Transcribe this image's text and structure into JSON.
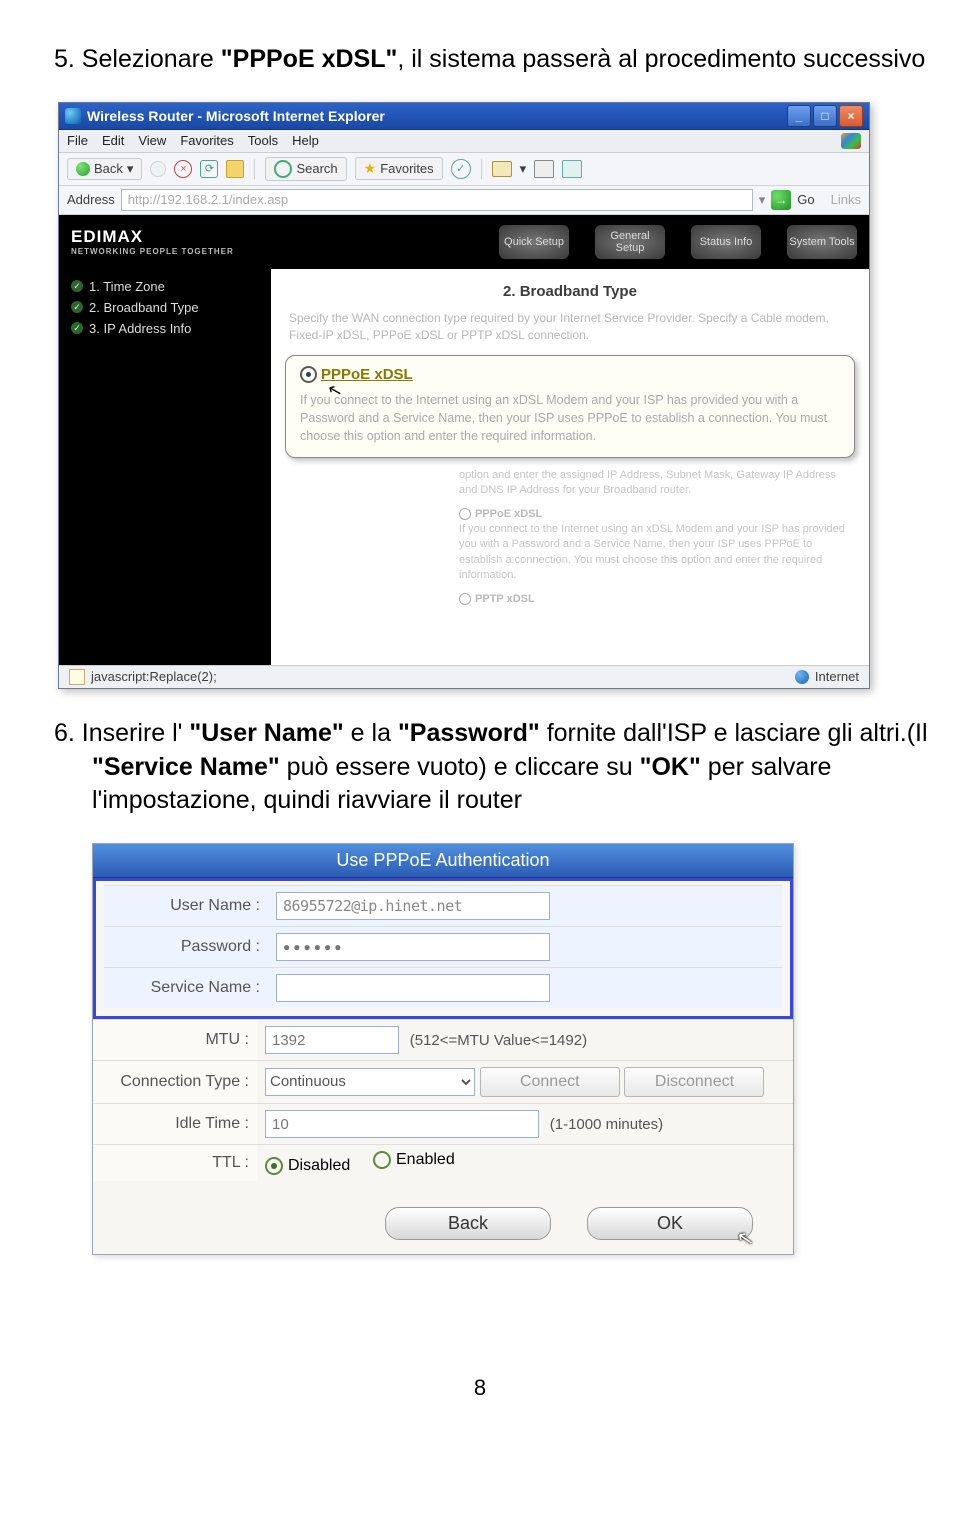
{
  "step5": {
    "number": "5.",
    "before": " Selezionare ",
    "term": "\"PPPoE xDSL\"",
    "after": ", il sistema passerà al procedimento successivo"
  },
  "shot1": {
    "title": "Wireless Router - Microsoft Internet Explorer",
    "menu": [
      "File",
      "Edit",
      "View",
      "Favorites",
      "Tools",
      "Help"
    ],
    "back": "Back",
    "search": "Search",
    "favorites": "Favorites",
    "address_label": "Address",
    "address_value": "http://192.168.2.1/index.asp",
    "go": "Go",
    "links": "Links",
    "logo": "EDIMAX",
    "logo_sub": "NETWORKING PEOPLE TOGETHER",
    "nav": [
      "Quick Setup",
      "General Setup",
      "Status Info",
      "System Tools"
    ],
    "sidebar": [
      "1. Time Zone",
      "2. Broadband Type",
      "3. IP Address Info"
    ],
    "h2": "2. Broadband Type",
    "intro": "Specify the WAN connection type required by your Internet Service Provider. Specify a Cable modem, Fixed-IP xDSL, PPPoE xDSL or PPTP xDSL connection.",
    "callout_title": "PPPoE xDSL",
    "callout_body": "If you connect to the Internet using an xDSL Modem and your ISP has provided you with a Password and a Service Name, then your ISP uses PPPoE to establish a connection. You must choose this option and enter the required information.",
    "faint1": "option and enter the assigned IP Address, Subnet Mask, Gateway IP Address and DNS IP Address for your Broadband router.",
    "faint2_title": "PPPoE xDSL",
    "faint2_body": "If you connect to the Internet using an xDSL Modem and your ISP has provided you with a Password and a Service Name, then your ISP uses PPPoE to establish a connection. You must choose this option and enter the required information.",
    "faint3_title": "PPTP xDSL",
    "status_left": "javascript:Replace(2);",
    "status_right": "Internet"
  },
  "step6": {
    "number": "6.",
    "t1": " Inserire l' ",
    "b1": "\"User Name\"",
    "t2": " e la ",
    "b2": "\"Password\"",
    "t3": " fornite dall'ISP e lasciare gli altri.(Il ",
    "b3": "\"Service Name\"",
    "t4": " può essere vuoto) e cliccare su ",
    "b4": "\"OK\"",
    "t5": " per salvare l'impostazione, quindi riavviare il router"
  },
  "shot2": {
    "title": "Use PPPoE Authentication",
    "labels": {
      "user": "User Name :",
      "pass": "Password :",
      "svc": "Service Name :",
      "mtu": "MTU :",
      "ctype": "Connection Type :",
      "idle": "Idle Time :",
      "ttl": "TTL :"
    },
    "values": {
      "user": "86955722@ip.hinet.net",
      "pass": "●●●●●●",
      "svc": "",
      "mtu": "1392",
      "mtu_note": "(512<=MTU Value<=1492)",
      "ctype": "Continuous",
      "idle": "10",
      "idle_note": "(1-1000 minutes)"
    },
    "buttons": {
      "connect": "Connect",
      "disconnect": "Disconnect",
      "back": "Back",
      "ok": "OK"
    },
    "ttl_disabled": "Disabled",
    "ttl_enabled": "Enabled"
  },
  "page_number": "8"
}
